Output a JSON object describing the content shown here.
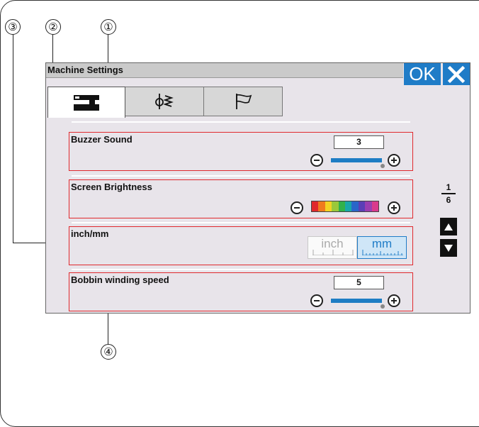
{
  "callouts": {
    "c1": "①",
    "c2": "②",
    "c3": "③",
    "c4": "④"
  },
  "screen": {
    "title": "Machine Settings",
    "ok_label": "OK",
    "close_icon": "close-x-icon",
    "tabs": [
      {
        "icon": "sewing-machine-icon",
        "active": true
      },
      {
        "icon": "stitch-icon",
        "active": false
      },
      {
        "icon": "flag-icon",
        "active": false
      }
    ],
    "settings": {
      "buzzer": {
        "label": "Buzzer Sound",
        "value": "3",
        "level": 1.0
      },
      "brightness": {
        "label": "Screen Brightness",
        "colors": [
          "#e0282c",
          "#f07a1e",
          "#f3d222",
          "#9ac83a",
          "#32b14a",
          "#18a7a8",
          "#2a66c9",
          "#5b3fb6",
          "#9a3eb0",
          "#d93a8c"
        ]
      },
      "units": {
        "label": "inch/mm",
        "inch_label": "inch",
        "mm_label": "mm",
        "selected": "mm"
      },
      "bobbin": {
        "label": "Bobbin winding speed",
        "value": "5",
        "level": 1.0
      }
    },
    "pager": {
      "current": "1",
      "total": "6"
    },
    "colors": {
      "accent": "#1f7cc7",
      "highlight": "#e0292e"
    }
  }
}
